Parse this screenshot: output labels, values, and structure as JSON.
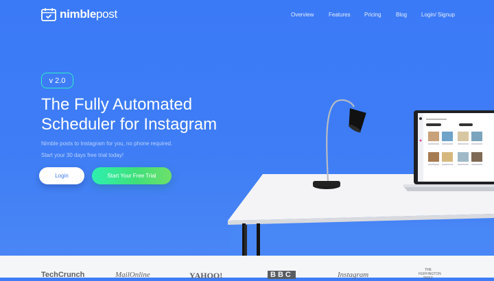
{
  "brand": {
    "name_bold": "nimble",
    "name_light": "post"
  },
  "nav": {
    "items": [
      "Overview",
      "Features",
      "Pricing",
      "Blog",
      "Login/ Signup"
    ]
  },
  "hero": {
    "version": "v 2.0",
    "headline_line1": "The Fully Automated",
    "headline_line2": "Scheduler for Instagram",
    "sub_line1": "Nimble posts to Instagram for you, no phone required.",
    "sub_line2": "Start your 30 days free trial today!",
    "login_label": "Login",
    "trial_label": "Start Your Free Trial"
  },
  "colors": {
    "background": "#3f7df6",
    "accent_outline": "#2ff0c6",
    "trial_gradient_start": "#2ef0b0",
    "trial_gradient_end": "#6ee06a"
  },
  "press_logos": [
    "TechCrunch",
    "MailOnline",
    "YAHOO!",
    "BBC",
    "Instagram",
    "THE HUFFINGTON POST"
  ]
}
